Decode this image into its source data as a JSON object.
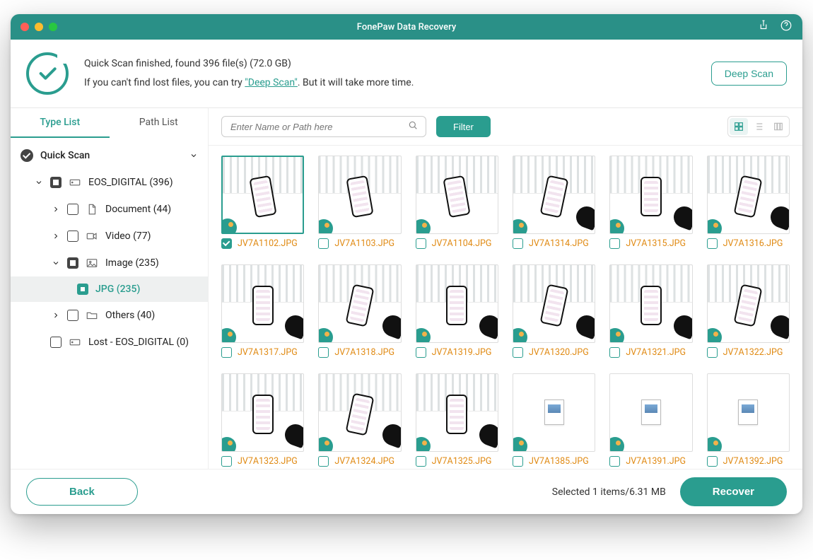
{
  "app": {
    "title": "FonePaw Data Recovery"
  },
  "banner": {
    "line1": "Quick Scan finished, found 396 file(s) (72.0 GB)",
    "line2_pre": "If you can't find lost files, you can try ",
    "link": "\"Deep Scan\"",
    "line2_post": ". But it will take more time.",
    "deep_scan_btn": "Deep Scan"
  },
  "sidebar": {
    "tabs": {
      "type": "Type List",
      "path": "Path List"
    },
    "quick_scan": "Quick Scan",
    "nodes": {
      "eos": "EOS_DIGITAL (396)",
      "doc": "Document (44)",
      "video": "Video (77)",
      "image": "Image (235)",
      "jpg": "JPG (235)",
      "others": "Others (40)",
      "lost": "Lost - EOS_DIGITAL (0)"
    }
  },
  "toolbar": {
    "search_placeholder": "Enter Name or Path here",
    "filter": "Filter"
  },
  "files": [
    {
      "name": "JV7A1102.JPG",
      "kind": "photo-tilt1",
      "selected": true
    },
    {
      "name": "JV7A1103.JPG",
      "kind": "photo-tilt1",
      "selected": false
    },
    {
      "name": "JV7A1104.JPG",
      "kind": "photo-tilt1",
      "selected": false
    },
    {
      "name": "JV7A1314.JPG",
      "kind": "photo-hand",
      "selected": false
    },
    {
      "name": "JV7A1315.JPG",
      "kind": "photo-hand",
      "selected": false
    },
    {
      "name": "JV7A1316.JPG",
      "kind": "photo-hand",
      "selected": false
    },
    {
      "name": "JV7A1317.JPG",
      "kind": "photo-hand",
      "selected": false
    },
    {
      "name": "JV7A1318.JPG",
      "kind": "photo-hand",
      "selected": false
    },
    {
      "name": "JV7A1319.JPG",
      "kind": "photo-hand",
      "selected": false
    },
    {
      "name": "JV7A1320.JPG",
      "kind": "photo-hand",
      "selected": false
    },
    {
      "name": "JV7A1321.JPG",
      "kind": "photo-hand",
      "selected": false
    },
    {
      "name": "JV7A1322.JPG",
      "kind": "photo-hand",
      "selected": false
    },
    {
      "name": "JV7A1323.JPG",
      "kind": "photo-hand",
      "selected": false
    },
    {
      "name": "JV7A1324.JPG",
      "kind": "photo-hand",
      "selected": false
    },
    {
      "name": "JV7A1325.JPG",
      "kind": "photo-hand",
      "selected": false
    },
    {
      "name": "JV7A1385.JPG",
      "kind": "doc",
      "selected": false
    },
    {
      "name": "JV7A1391.JPG",
      "kind": "doc",
      "selected": false
    },
    {
      "name": "JV7A1392.JPG",
      "kind": "doc",
      "selected": false
    }
  ],
  "footer": {
    "back": "Back",
    "selection": "Selected 1 items/6.31 MB",
    "recover": "Recover"
  }
}
